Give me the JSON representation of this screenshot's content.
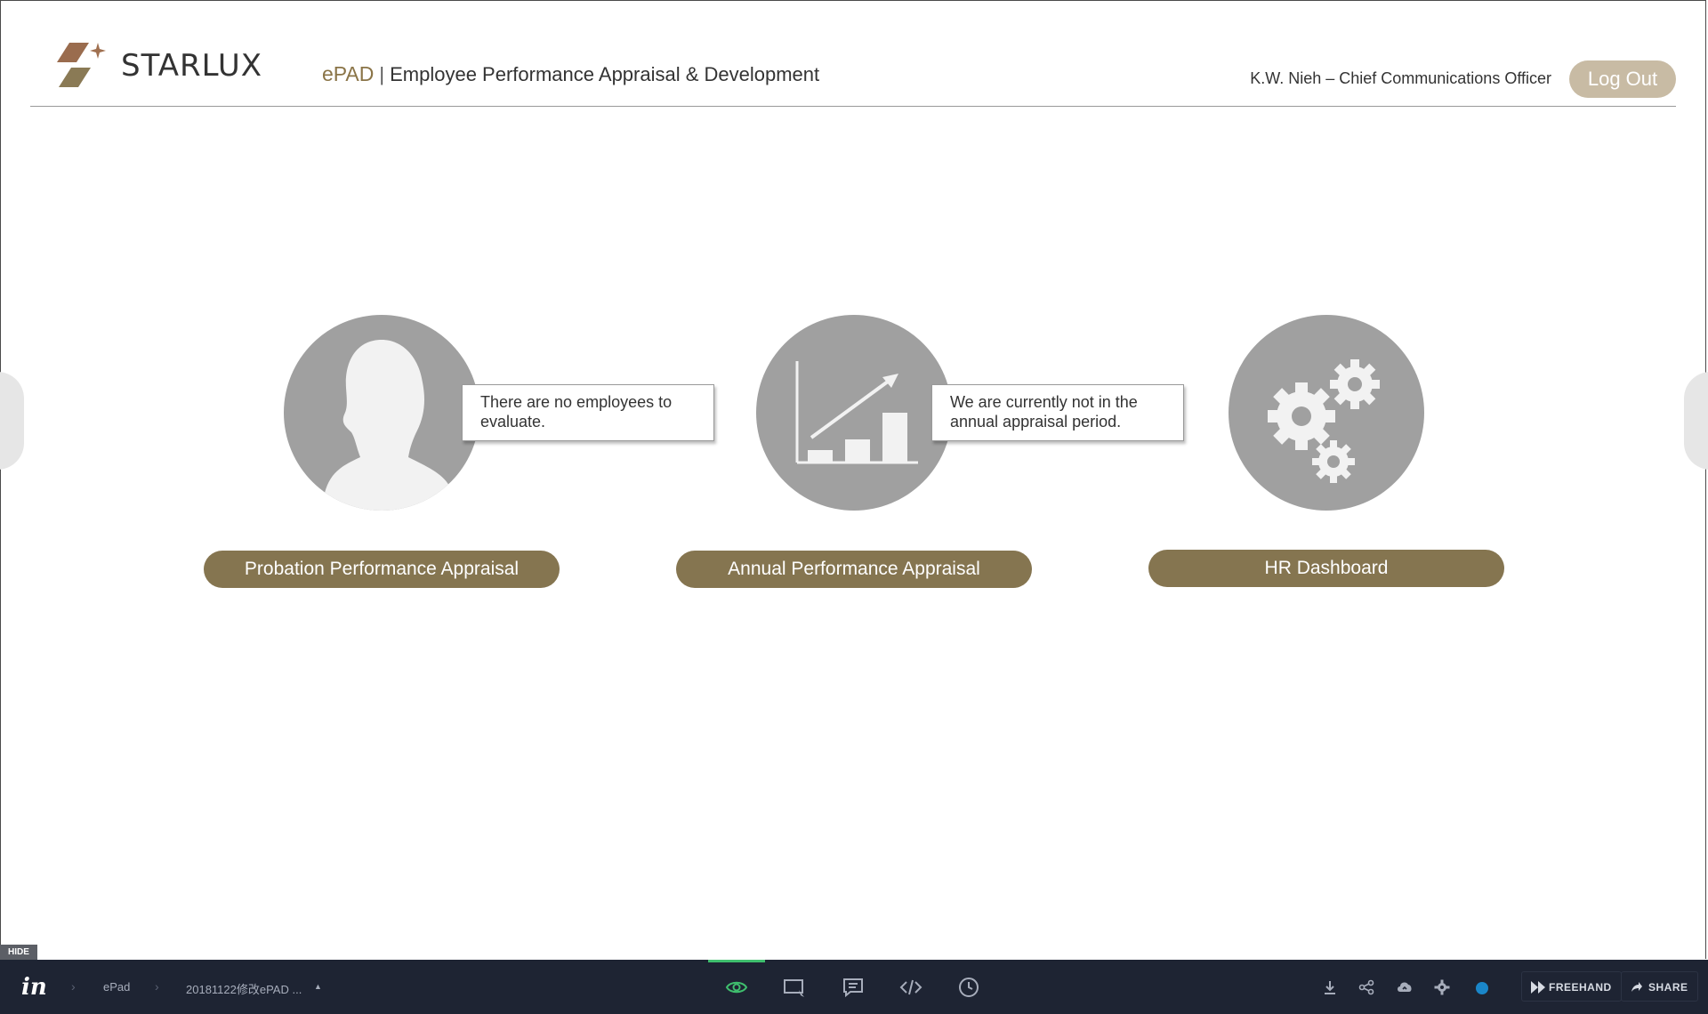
{
  "header": {
    "brand_name": "STARLUX",
    "app_short": "ePAD",
    "app_separator": "|",
    "app_full": "Employee Performance Appraisal & Development",
    "user": "K.W. Nieh – Chief Communications Officer",
    "logout_label": "Log Out"
  },
  "cards": [
    {
      "icon": "person-icon",
      "label": "Probation Performance Appraisal",
      "tooltip": "There are no employees to evaluate."
    },
    {
      "icon": "bar-chart-growth-icon",
      "label": "Annual Performance Appraisal",
      "tooltip": "We are currently not in the annual appraisal period."
    },
    {
      "icon": "gears-icon",
      "label": "HR Dashboard",
      "tooltip": ""
    }
  ],
  "prototype_toolbar": {
    "hide_label": "HIDE",
    "logo": "in",
    "breadcrumb": [
      "ePad",
      "20181122修改ePAD ..."
    ],
    "center_icons": [
      "eye-icon",
      "screen-icon",
      "comment-icon",
      "code-icon",
      "clock-icon"
    ],
    "right_icons": [
      "download-icon",
      "share-nodes-icon",
      "cloud-upload-icon",
      "gear-icon"
    ],
    "freehand_label": "FREEHAND",
    "share_label": "SHARE"
  },
  "colors": {
    "brand_gold": "#857550",
    "logout_bg": "#c8bba4",
    "icon_circle": "#a0a0a0",
    "toolbar_bg": "#1e2433",
    "active_green": "#3fbf6e"
  }
}
